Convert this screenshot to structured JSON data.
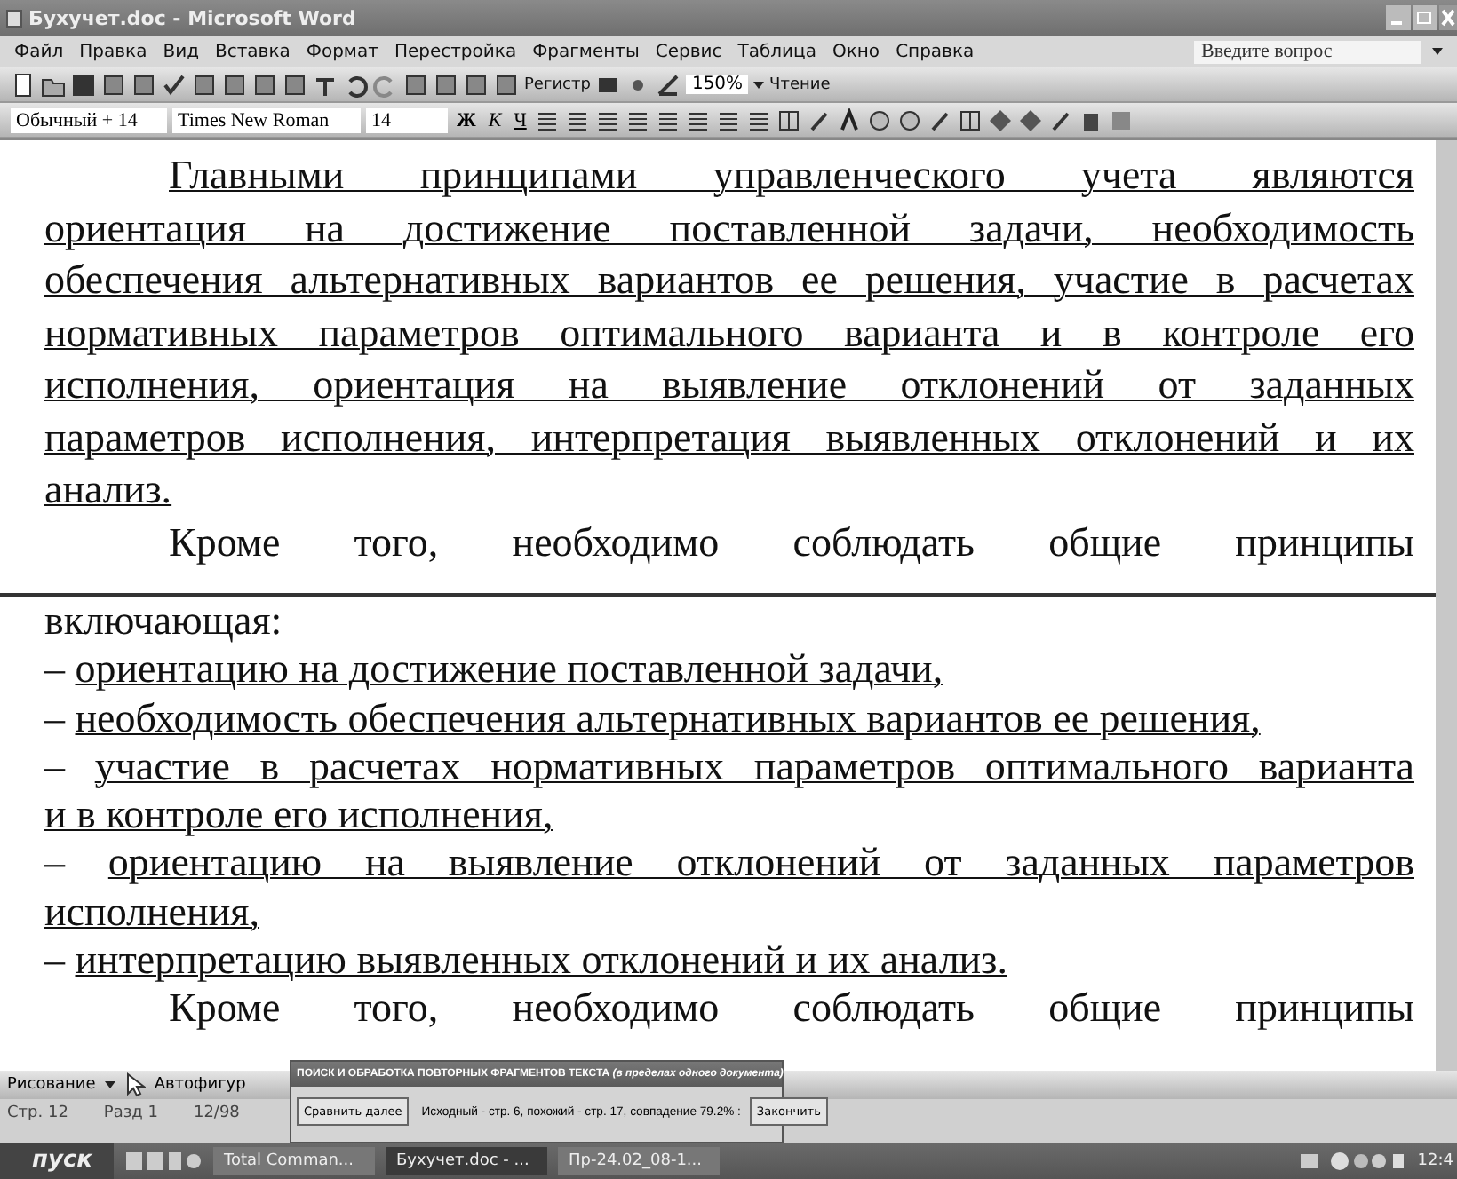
{
  "window": {
    "title": "Бухучет.doc - Microsoft Word"
  },
  "menu": [
    "Файл",
    "Правка",
    "Вид",
    "Вставка",
    "Формат",
    "Перестройка",
    "Фрагменты",
    "Сервис",
    "Таблица",
    "Окно",
    "Справка"
  ],
  "question_box": {
    "placeholder": "Введите вопрос"
  },
  "standard_toolbar": {
    "register_label": "Регистр",
    "zoom": "150%",
    "reading_label": "Чтение"
  },
  "format_toolbar": {
    "style": "Обычный + 14",
    "font": "Times New Roman",
    "size": "14",
    "bold": "Ж",
    "italic": "К",
    "underline": "Ч"
  },
  "top_pane": [
    {
      "kind": "paragraph",
      "underline": true,
      "lines": [
        "Главными принципами управленческого учета являются",
        "ориентация на достижение поставленной задачи, необходимость",
        "обеспечения альтернативных вариантов ее решения, участие в расчетах",
        "нормативных параметров оптимального варианта и в контроле его",
        "исполнения, ориентация на выявление отклонений от заданных",
        "параметров исполнения, интерпретация выявленных отклонений и их",
        "анализ."
      ]
    },
    {
      "kind": "cut",
      "underline": false,
      "lines": [
        "Кроме того, необходимо соблюдать общие принципы"
      ]
    }
  ],
  "bottom_pane": [
    {
      "kind": "plain",
      "underline": false,
      "lines": [
        "включающая:"
      ]
    },
    {
      "kind": "item",
      "marker": "–",
      "underline": true,
      "lines": [
        "ориентацию на достижение поставленной задачи,"
      ]
    },
    {
      "kind": "item",
      "marker": "–",
      "underline": true,
      "lines": [
        "необходимость обеспечения альтернативных вариантов ее решения,"
      ]
    },
    {
      "kind": "item",
      "marker": "–",
      "underline": true,
      "lines": [
        "участие в расчетах нормативных параметров оптимального варианта",
        "и в контроле его исполнения,"
      ]
    },
    {
      "kind": "item",
      "marker": "–",
      "underline": true,
      "lines": [
        "ориентацию на выявление отклонений от заданных параметров",
        "исполнения,"
      ]
    },
    {
      "kind": "item",
      "marker": "–",
      "underline": true,
      "lines": [
        "интерпретацию выявленных отклонений и их анализ."
      ]
    },
    {
      "kind": "cut",
      "underline": false,
      "lines": [
        "Кроме того, необходимо соблюдать общие принципы"
      ]
    }
  ],
  "drawing_toolbar": {
    "drawing": "Рисование",
    "autoshapes": "Автофигур"
  },
  "status_bar": [
    "Стр. 12",
    "Разд 1",
    "12/98"
  ],
  "dialog": {
    "title": "ПОИСК И ОБРАБОТКА ПОВТОРНЫХ ФРАГМЕНТОВ ТЕКСТА *(в пределах одного документа)*",
    "next_button": "Сравнить далее",
    "info": "Исходный - стр. 6, похожий - стр. 17, совпадение 79.2% :",
    "finish_button": "Закончить"
  },
  "taskbar": {
    "start": "пуск",
    "tasks": [
      {
        "label": "Total Comman...",
        "selected": false
      },
      {
        "label": "Бухучет.doc - ...",
        "selected": true
      },
      {
        "label": "Пр-24.02_08-1...",
        "selected": false
      }
    ],
    "clock": "12:4"
  }
}
